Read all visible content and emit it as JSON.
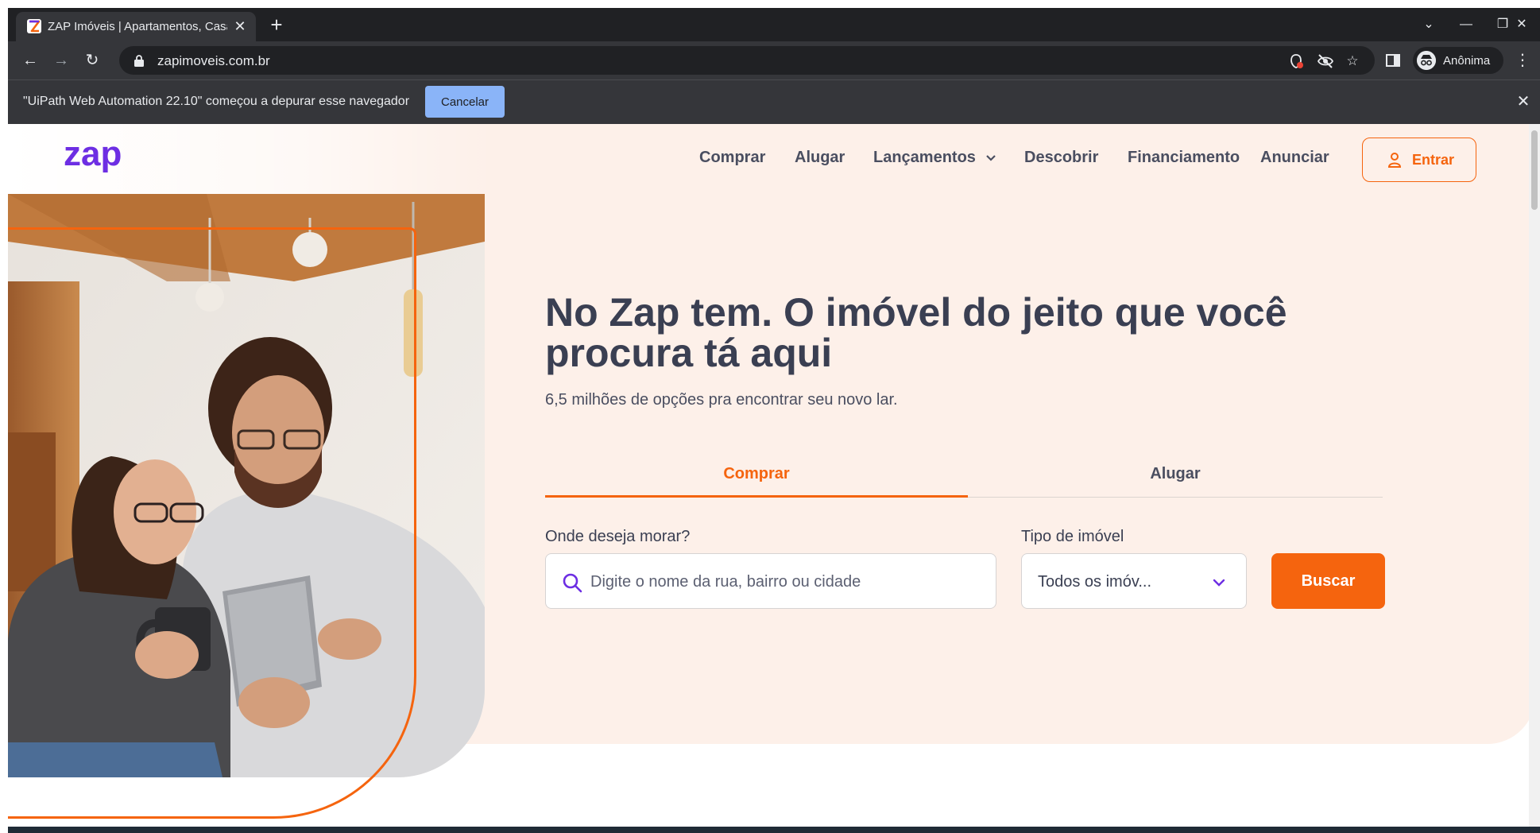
{
  "browser": {
    "tab_title": "ZAP Imóveis | Apartamentos, Casas",
    "new_tab": "+",
    "url": "zapimoveis.com.br",
    "profile_name": "Anônima",
    "window_controls": {
      "minimize": "—",
      "restore": "❐",
      "close": "✕",
      "tab_search": "⌄"
    },
    "infobar": {
      "message": "\"UiPath Web Automation 22.10\" começou a depurar esse navegador",
      "cancel_label": "Cancelar"
    }
  },
  "site": {
    "logo_text": "zap",
    "nav": {
      "comprar": "Comprar",
      "alugar": "Alugar",
      "lancamentos": "Lançamentos",
      "descobrir": "Descobrir",
      "financiamento": "Financiamento",
      "anunciar": "Anunciar",
      "entrar": "Entrar"
    },
    "hero": {
      "headline": "No Zap tem. O imóvel do jeito que você procura tá aqui",
      "subhead": "6,5 milhões de opções pra encontrar seu novo lar.",
      "tabs": {
        "active": "Comprar",
        "inactive": "Alugar"
      },
      "where_label": "Onde deseja morar?",
      "search_placeholder": "Digite o nome da rua, bairro ou cidade",
      "type_label": "Tipo de imóvel",
      "type_value": "Todos os imóv...",
      "search_button": "Buscar"
    }
  },
  "colors": {
    "brand_orange": "#f5640e",
    "brand_purple": "#6d2ee3",
    "hero_background": "#fdf0e9",
    "text_dark": "#3a3f52"
  }
}
